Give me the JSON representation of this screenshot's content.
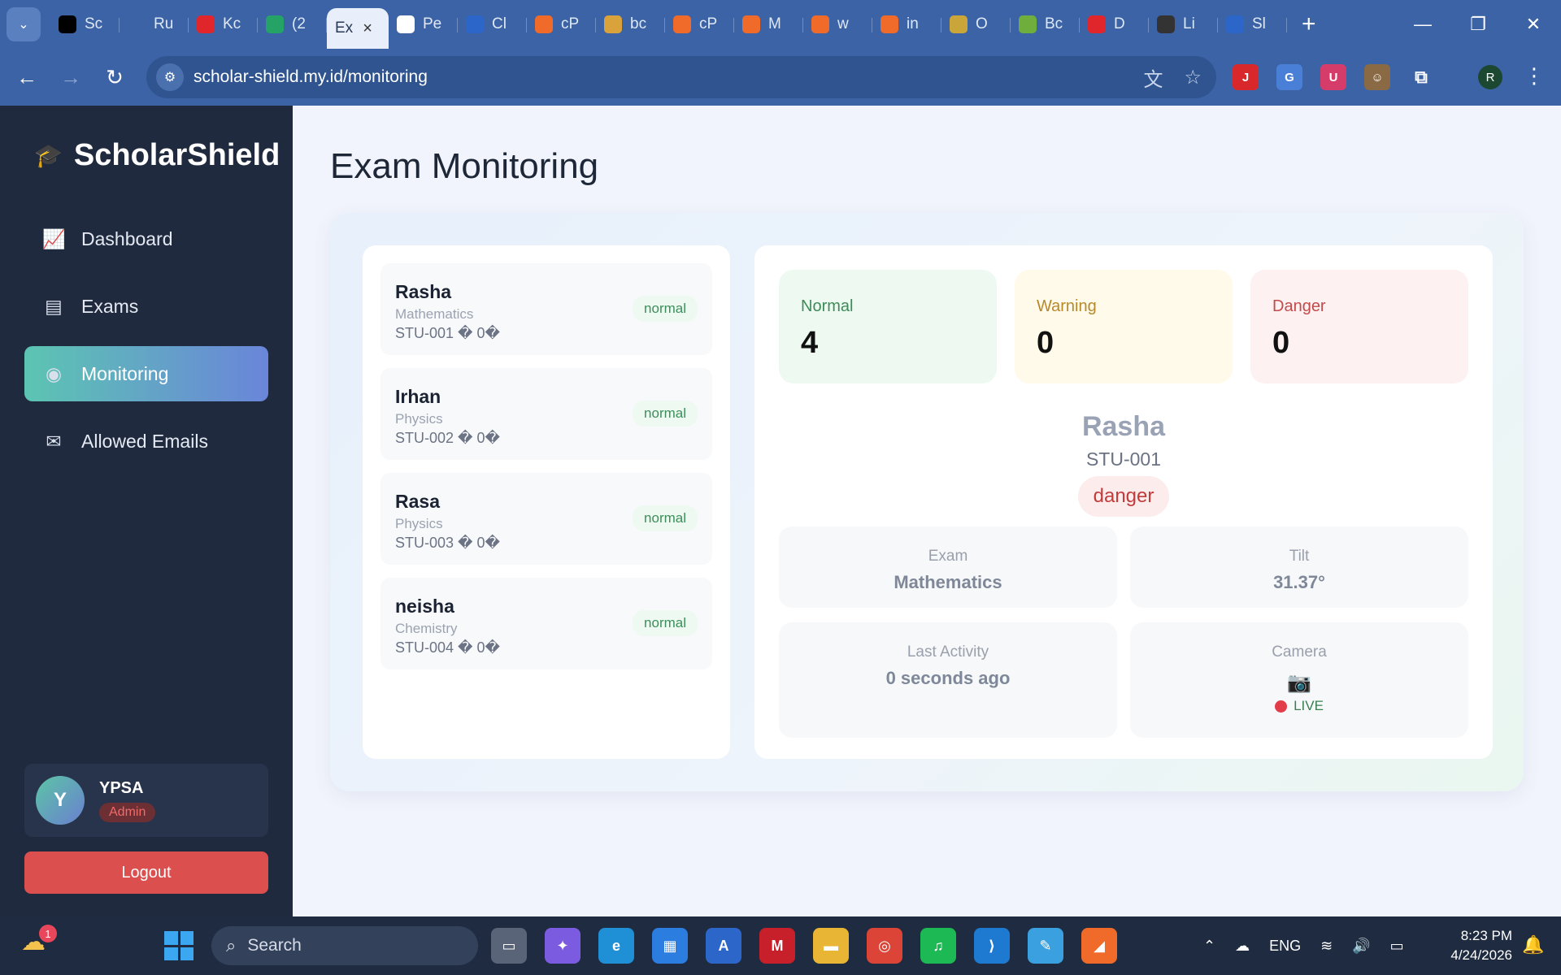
{
  "browser": {
    "tabs": [
      {
        "label": "Sc",
        "icon": "threads-icon",
        "color": "#000000"
      },
      {
        "label": "Ru",
        "icon": "link-icon",
        "color": "#3b63a6"
      },
      {
        "label": "Kc",
        "icon": "youtube-icon",
        "color": "#e0262b"
      },
      {
        "label": "(2",
        "icon": "whatsapp-icon",
        "color": "#25a366"
      },
      {
        "label": "Ex",
        "icon": "",
        "color": "#e8effa",
        "active": true
      },
      {
        "label": "Pe",
        "icon": "chatgpt-icon",
        "color": "#ffffff"
      },
      {
        "label": "Cl",
        "icon": "a-logo-icon",
        "color": "#2c66c9"
      },
      {
        "label": "cP",
        "icon": "cpanel-icon",
        "color": "#f06a2a"
      },
      {
        "label": "bc",
        "icon": "emblem-icon",
        "color": "#d9a23a"
      },
      {
        "label": "cP",
        "icon": "cpanel-icon",
        "color": "#f06a2a"
      },
      {
        "label": "M",
        "icon": "cpanel-icon",
        "color": "#f06a2a"
      },
      {
        "label": "w",
        "icon": "cpanel-icon",
        "color": "#f06a2a"
      },
      {
        "label": "in",
        "icon": "cpanel-icon",
        "color": "#f06a2a"
      },
      {
        "label": "O",
        "icon": "shield-icon",
        "color": "#c9a53a"
      },
      {
        "label": "Bc",
        "icon": "figure-icon",
        "color": "#6fae3d"
      },
      {
        "label": "D",
        "icon": "map-pin-icon",
        "color": "#e0262b"
      },
      {
        "label": "Li",
        "icon": "ball-icon",
        "color": "#333333"
      },
      {
        "label": "Sl",
        "icon": "a-logo-icon",
        "color": "#2c66c9"
      }
    ],
    "url": "scholar-shield.my.id/monitoring"
  },
  "sidebar": {
    "brand": "ScholarShield",
    "nav": [
      {
        "label": "Dashboard",
        "icon": "chart-line-icon",
        "glyph": "📈"
      },
      {
        "label": "Exams",
        "icon": "document-icon",
        "glyph": "▤"
      },
      {
        "label": "Monitoring",
        "icon": "eye-icon",
        "glyph": "◉",
        "active": true
      },
      {
        "label": "Allowed Emails",
        "icon": "mail-icon",
        "glyph": "✉"
      }
    ],
    "user": {
      "initial": "Y",
      "name": "YPSA",
      "role": "Admin"
    },
    "logout_label": "Logout"
  },
  "main": {
    "title": "Exam Monitoring",
    "students": [
      {
        "name": "Rasha",
        "subject": "Mathematics",
        "id_line": "STU-001 � 0�",
        "status": "normal"
      },
      {
        "name": "Irhan",
        "subject": "Physics",
        "id_line": "STU-002 � 0�",
        "status": "normal"
      },
      {
        "name": "Rasa",
        "subject": "Physics",
        "id_line": "STU-003 � 0�",
        "status": "normal"
      },
      {
        "name": "neisha",
        "subject": "Chemistry",
        "id_line": "STU-004 � 0�",
        "status": "normal"
      }
    ],
    "stats": {
      "normal": {
        "label": "Normal",
        "value": "4"
      },
      "warning": {
        "label": "Warning",
        "value": "0"
      },
      "danger": {
        "label": "Danger",
        "value": "0"
      }
    },
    "selected": {
      "name": "Rasha",
      "id": "STU-001",
      "status": "danger",
      "exam_label": "Exam",
      "exam_value": "Mathematics",
      "tilt_label": "Tilt",
      "tilt_value": "31.37°",
      "activity_label": "Last Activity",
      "activity_value": "0 seconds ago",
      "camera_label": "Camera",
      "camera_status": "LIVE"
    }
  },
  "taskbar": {
    "search_placeholder": "Search",
    "notification_count": "1",
    "language": "ENG",
    "time": "8:23 PM",
    "date": "4/24/2026"
  }
}
